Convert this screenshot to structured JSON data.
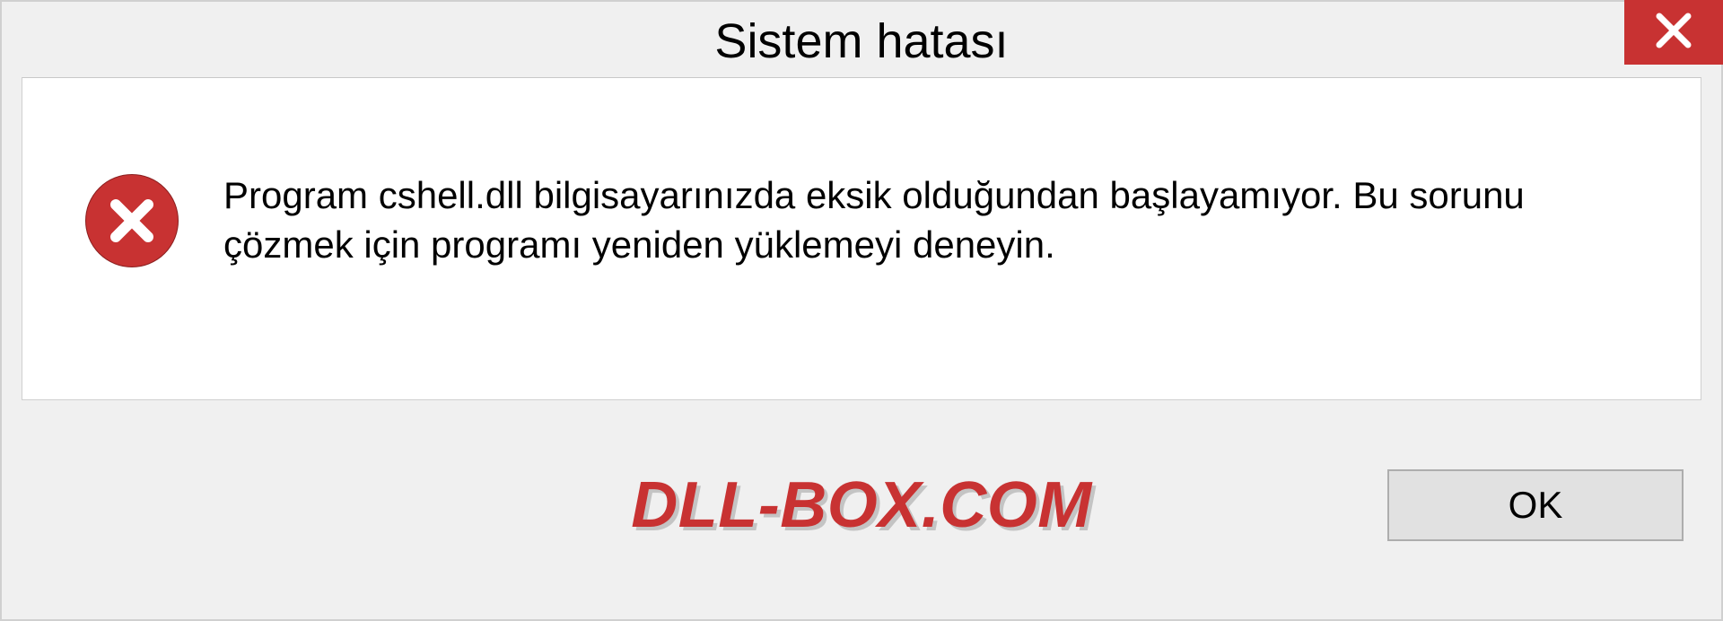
{
  "dialog": {
    "title": "Sistem hatası",
    "message": "Program cshell.dll bilgisayarınızda eksik olduğundan başlayamıyor. Bu sorunu çözmek için programı yeniden yüklemeyi deneyin.",
    "ok_label": "OK"
  },
  "watermark": "DLL-BOX.COM",
  "colors": {
    "accent_red": "#c83232",
    "bg": "#f0f0f0"
  }
}
